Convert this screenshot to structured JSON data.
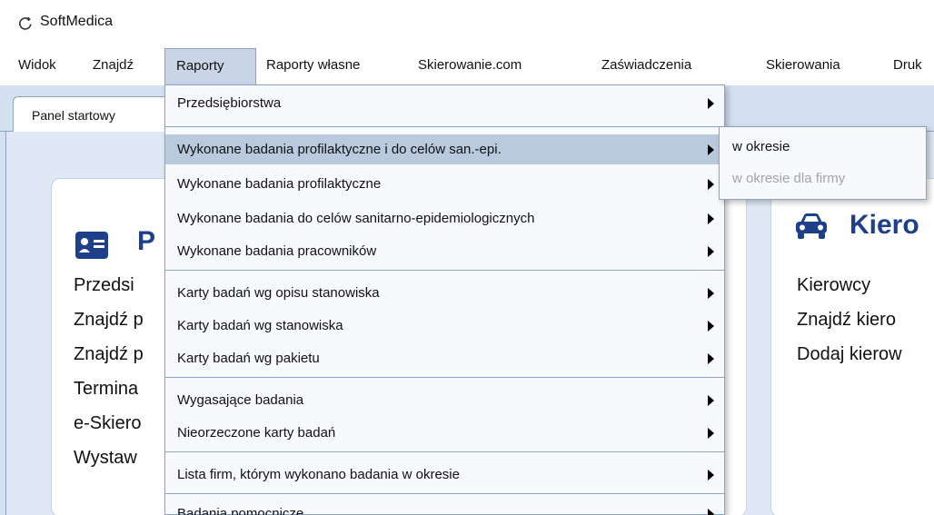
{
  "app": {
    "title": "SoftMedica"
  },
  "menubar": {
    "items": [
      "Widok",
      "Znajdź",
      "Raporty",
      "Raporty własne",
      "Skierowanie.com",
      "Zaświadczenia",
      "Skierowania",
      "Druk"
    ]
  },
  "tabs": [
    {
      "label": "Panel startowy"
    }
  ],
  "panels": {
    "left": {
      "title": "P",
      "links": [
        "Przedsi",
        "Znajdź p",
        "Znajdź p",
        "Termina",
        "e-Skiero",
        "Wystaw"
      ]
    },
    "right": {
      "title": "Kiero",
      "links": [
        "Kierowcy",
        "Znajdź kiero",
        "Dodaj kierow"
      ]
    }
  },
  "dropdown": {
    "items": [
      {
        "label": "Przedsiębiorstwa"
      },
      {
        "label": "Wykonane badania profilaktyczne i do celów san.-epi."
      },
      {
        "label": "Wykonane badania profilaktyczne"
      },
      {
        "label": "Wykonane badania do celów sanitarno-epidemiologicznych"
      },
      {
        "label": "Wykonane badania pracowników"
      },
      {
        "label": "Karty badań wg opisu stanowiska"
      },
      {
        "label": "Karty badań wg stanowiska"
      },
      {
        "label": "Karty badań wg pakietu"
      },
      {
        "label": "Wygasające badania"
      },
      {
        "label": "Nieorzeczone karty badań"
      },
      {
        "label": "Lista firm, którym wykonano badania w okresie"
      },
      {
        "label": "Badania pomocnicze"
      }
    ]
  },
  "submenu": {
    "items": [
      {
        "label": "w okresie",
        "enabled": true
      },
      {
        "label": "w okresie dla firmy",
        "enabled": false
      }
    ]
  },
  "colors": {
    "accent": "#1e3f8a",
    "highlight": "#b9c9de",
    "border": "#8da3c4",
    "disabled_text": "#a3a3a3"
  }
}
